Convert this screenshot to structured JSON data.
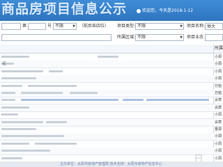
{
  "header": {
    "title": "商品房项目信息公示",
    "user_text": "欢迎您，今天是2018-1-12"
  },
  "filter": {
    "row1": {
      "label_ce": "第",
      "label_hao": "号",
      "sel_1_value": "不限",
      "sel_1_hint": "（前后各四位）",
      "label_project_type": "项目类型:",
      "sel_project_type": "不限",
      "label_project_name": "项目名称:",
      "input_project_name": "恒大"
    },
    "row2": {
      "label_area": "所属区域:",
      "sel_area": "不限",
      "label_project_address": "项目业态"
    }
  },
  "table": {
    "header_right": "所属",
    "rows": [
      {
        "left": "",
        "right": "小洞"
      },
      {
        "left": "-区",
        "right": "小洞"
      },
      {
        "left": "",
        "right": "小洞"
      },
      {
        "left": "",
        "right": "小洞"
      },
      {
        "left": "",
        "right": "万柏"
      },
      {
        "left": "",
        "right": "万柏"
      },
      {
        "left": "",
        "right": "尖草"
      },
      {
        "left": "",
        "right": "尖草"
      },
      {
        "left": "-",
        "right": "小洞"
      },
      {
        "left": "",
        "right": "尖草"
      },
      {
        "left": "",
        "right": "晋源"
      },
      {
        "left": "",
        "right": "小洞"
      },
      {
        "left": "",
        "right": "小洞"
      },
      {
        "left": "",
        "right": "小洞"
      },
      {
        "left": "",
        "right": "小洞"
      }
    ]
  },
  "footer": {
    "text": "主办单位：太原市房地产管理局  技术支持：太原市房地产信息中心"
  },
  "colors": {
    "header_bg": "#2f74c0",
    "link": "#3a6fbf"
  }
}
